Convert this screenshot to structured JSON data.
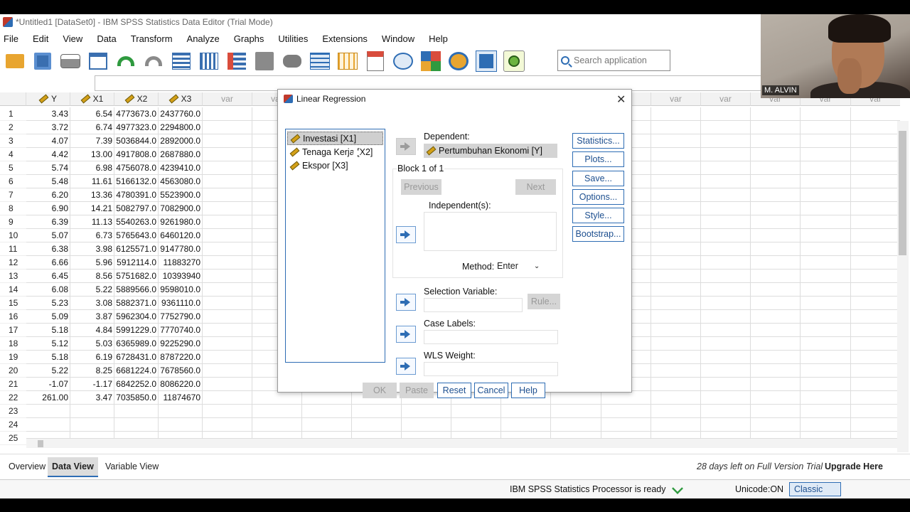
{
  "window": {
    "title": "*Untitled1 [DataSet0] - IBM SPSS Statistics Data Editor (Trial Mode)"
  },
  "menu": [
    "File",
    "Edit",
    "View",
    "Data",
    "Transform",
    "Analyze",
    "Graphs",
    "Utilities",
    "Extensions",
    "Window",
    "Help"
  ],
  "search": {
    "placeholder": "Search application"
  },
  "grid": {
    "columns": [
      "Y",
      "X1",
      "X2",
      "X3"
    ],
    "var_label": "var",
    "rows": [
      [
        "3.43",
        "6.54",
        "4773673.0",
        "2437760.0"
      ],
      [
        "3.72",
        "6.74",
        "4977323.0",
        "2294800.0"
      ],
      [
        "4.07",
        "7.39",
        "5036844.0",
        "2892000.0"
      ],
      [
        "4.42",
        "13.00",
        "4917808.0",
        "2687880.0"
      ],
      [
        "5.74",
        "6.98",
        "4756078.0",
        "4239410.0"
      ],
      [
        "5.48",
        "11.61",
        "5166132.0",
        "4563080.0"
      ],
      [
        "6.20",
        "13.36",
        "4780391.0",
        "5523900.0"
      ],
      [
        "6.90",
        "14.21",
        "5082797.0",
        "7082900.0"
      ],
      [
        "6.39",
        "11.13",
        "5540263.0",
        "9261980.0"
      ],
      [
        "5.07",
        "6.73",
        "5765643.0",
        "6460120.0"
      ],
      [
        "6.38",
        "3.98",
        "6125571.0",
        "9147780.0"
      ],
      [
        "6.66",
        "5.96",
        "5912114.0",
        "11883270"
      ],
      [
        "6.45",
        "8.56",
        "5751682.0",
        "10393940"
      ],
      [
        "6.08",
        "5.22",
        "5889566.0",
        "9598010.0"
      ],
      [
        "5.23",
        "3.08",
        "5882371.0",
        "9361110.0"
      ],
      [
        "5.09",
        "3.87",
        "5962304.0",
        "7752790.0"
      ],
      [
        "5.18",
        "4.84",
        "5991229.0",
        "7770740.0"
      ],
      [
        "5.12",
        "5.03",
        "6365989.0",
        "9225290.0"
      ],
      [
        "5.18",
        "6.19",
        "6728431.0",
        "8787220.0"
      ],
      [
        "5.22",
        "8.25",
        "6681224.0",
        "7678560.0"
      ],
      [
        "-1.07",
        "-1.17",
        "6842252.0",
        "8086220.0"
      ],
      [
        "261.00",
        "3.47",
        "7035850.0",
        "11874670"
      ]
    ],
    "row_numbers": [
      "1",
      "2",
      "3",
      "4",
      "5",
      "6",
      "7",
      "8",
      "9",
      "10",
      "11",
      "12",
      "13",
      "14",
      "15",
      "16",
      "17",
      "18",
      "19",
      "20",
      "21",
      "22",
      "23",
      "24",
      "25"
    ]
  },
  "tabs": {
    "overview": "Overview",
    "data_view": "Data View",
    "variable_view": "Variable View"
  },
  "trial": {
    "text": "28 days left on Full Version Trial",
    "upgrade": "Upgrade Here"
  },
  "status": {
    "processor": "IBM SPSS Statistics Processor is ready",
    "unicode": "Unicode:ON",
    "classic": "Classic"
  },
  "dialog": {
    "title": "Linear Regression",
    "variables": [
      "Investasi [X1]",
      "Tenaga Kerja [X2]",
      "Ekspor [X3]"
    ],
    "dependent_label": "Dependent:",
    "dependent_value": "Pertumbuhan Ekonomi [Y]",
    "block": "Block 1 of 1",
    "previous": "Previous",
    "next": "Next",
    "independent_label": "Independent(s):",
    "method_label": "Method:",
    "method_value": "Enter",
    "selection_label": "Selection Variable:",
    "rule": "Rule...",
    "case_labels": "Case Labels:",
    "wls_weight": "WLS Weight:",
    "side_buttons": [
      "Statistics...",
      "Plots...",
      "Save...",
      "Options...",
      "Style...",
      "Bootstrap..."
    ],
    "ok": "OK",
    "paste": "Paste",
    "reset": "Reset",
    "cancel": "Cancel",
    "help": "Help"
  },
  "webcam": {
    "name": "M. ALVIN"
  }
}
